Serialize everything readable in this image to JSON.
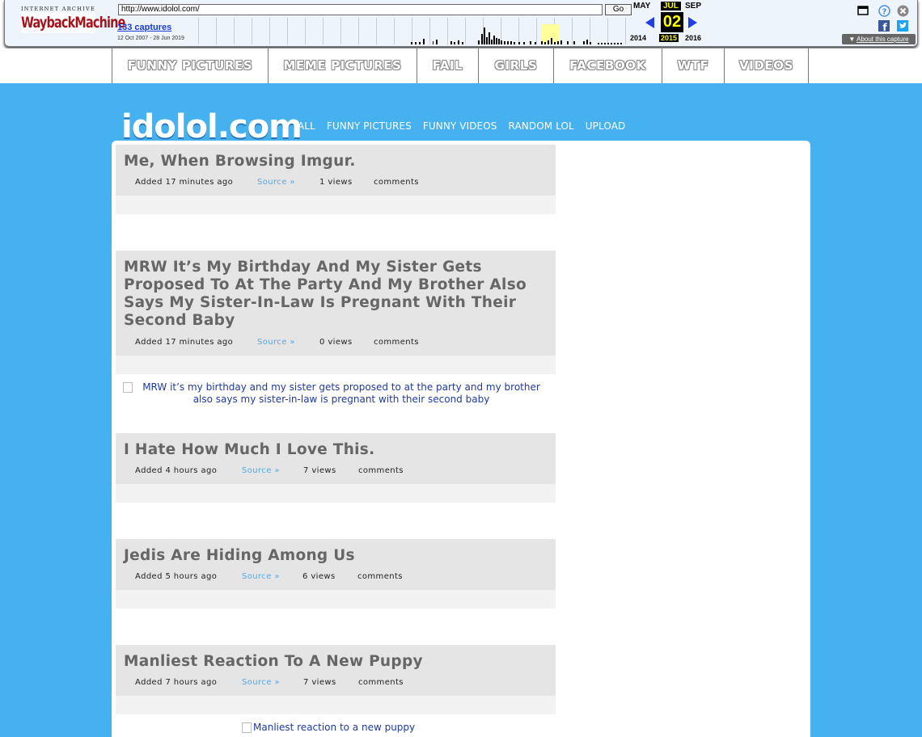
{
  "wayback": {
    "logo_top": "INTERNET ARCHIVE",
    "logo_main": "WaybackMachine",
    "url": "http://www.idolol.com/",
    "go_label": "Go",
    "captures": "133 captures",
    "range": "12 Oct 2007 - 28 Jun 2019",
    "prev_month": "MAY",
    "cur_month": "JUL",
    "next_month": "SEP",
    "day": "02",
    "prev_year": "2014",
    "cur_year": "2015",
    "next_year": "2016",
    "about": "About this capture"
  },
  "topnav": {
    "items": [
      {
        "label": "FUNNY PICTURES"
      },
      {
        "label": "MEME PICTURES"
      },
      {
        "label": "FAIL"
      },
      {
        "label": "GIRLS"
      },
      {
        "label": "FACEBOOK"
      },
      {
        "label": "WTF"
      },
      {
        "label": "VIDEOS"
      }
    ]
  },
  "site": {
    "logo": "idolol.com",
    "subnav": [
      "ALL",
      "FUNNY PICTURES",
      "FUNNY VIDEOS",
      "RANDOM LOL",
      "UPLOAD"
    ]
  },
  "posts": [
    {
      "title": "Me, When Browsing Imgur.",
      "added": "Added 17 minutes ago",
      "source": "Source »",
      "views": "1 views",
      "comments": "comments"
    },
    {
      "title": "MRW It’s My Birthday And My Sister Gets Proposed To At The Party And My Brother Also Says My Sister-In-Law Is Pregnant With Their Second Baby",
      "added": "Added 17 minutes ago",
      "source": "Source »",
      "views": "0 views",
      "comments": "comments",
      "image_alt": "MRW it’s my birthday and my sister gets proposed to at the party and my brother also says my sister-in-law is pregnant with their second baby"
    },
    {
      "title": "I Hate How Much I Love This.",
      "added": "Added 4 hours ago",
      "source": "Source »",
      "views": "7 views",
      "comments": "comments"
    },
    {
      "title": "Jedis Are Hiding Among Us",
      "added": "Added 5 hours ago",
      "source": "Source »",
      "views": "6 views",
      "comments": "comments"
    },
    {
      "title": "Manliest Reaction To A New Puppy",
      "added": "Added 7 hours ago",
      "source": "Source »",
      "views": "7 views",
      "comments": "comments",
      "image_alt": "Manliest reaction to a new puppy"
    }
  ]
}
